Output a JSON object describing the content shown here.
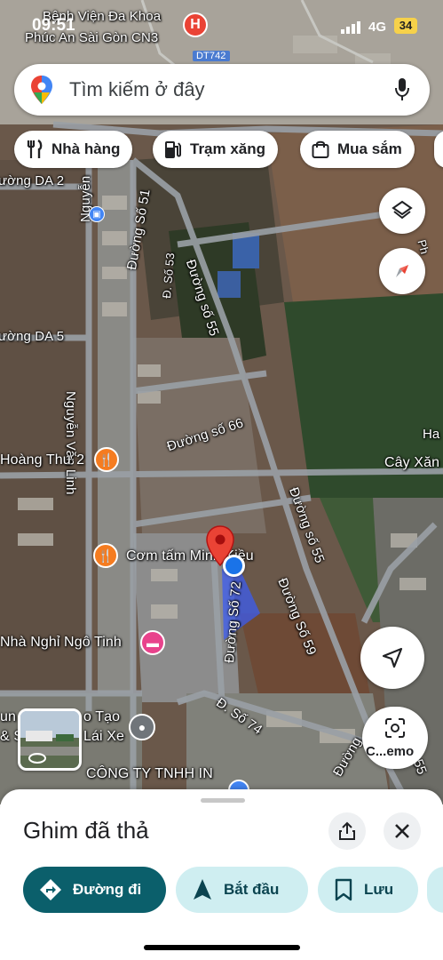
{
  "status_bar": {
    "time": "09:51",
    "network": "4G",
    "battery": "34"
  },
  "search": {
    "placeholder": "Tìm kiếm ở đây",
    "mic_icon": "mic-icon",
    "logo_icon": "maps-pin-logo-icon"
  },
  "chips": [
    {
      "label": "Nhà hàng",
      "icon": "restaurant-icon"
    },
    {
      "label": "Trạm xăng",
      "icon": "gas-station-icon"
    },
    {
      "label": "Mua sắm",
      "icon": "shopping-bag-icon"
    }
  ],
  "map": {
    "labels": {
      "hospital": "Bệnh Viện Đa Khoa",
      "hospital2": "Phúc An Sài Gòn CN3",
      "road_dt742": "DT742",
      "duong_da2": "ường DA 2",
      "duong_da5": "ường DA 5",
      "nguyen_van_linh": "Nguyễn Văn Linh",
      "nguyen_van_linh_top": "Nguyễn",
      "duong_so51": "Đường Số 51",
      "d_so53": "Đ. Số 53",
      "duong_so55": "Đường số 55",
      "duong_so66": "Đường số 66",
      "duong_so55b": "Đường số 55",
      "duong_so59": "Đường Số 59",
      "duong_so72": "Đường Số 72",
      "d_so74": "Đ. Số 74",
      "duong_bottom": "Đường",
      "hoang_thu": "Hoàng Thư 2",
      "com_tam": "Cơm tấm Minh Kiều",
      "nha_nghi": "Nhà Nghỉ Ngô Tinh",
      "dao_tao": "o Tạo",
      "lai_xe": "Lái Xe",
      "trun": "un",
      "s_left": "& S",
      "cong_ty": "CÔNG TY TNHH IN",
      "cay_xang": "Cây Xăn",
      "ha": "Ha",
      "ph": "Ph",
      "num55": "55"
    }
  },
  "buttons": {
    "layers_icon": "layers-icon",
    "compass_icon": "compass-icon",
    "location_icon": "my-location-arrow-icon",
    "lens_label": "C...emo"
  },
  "sheet": {
    "title": "Ghim đã thả",
    "actions": [
      {
        "label": "Đường đi",
        "icon": "directions-icon"
      },
      {
        "label": "Bắt đầu",
        "icon": "navigation-arrow-icon"
      },
      {
        "label": "Lưu",
        "icon": "bookmark-icon"
      }
    ]
  },
  "colors": {
    "accent_teal": "#0b5f6b",
    "chip_teal": "#cfeef1",
    "pin_red": "#ea4335",
    "blue_dot": "#1a73e8",
    "poi_orange": "#f57c20",
    "poi_pink": "#e8438c",
    "poi_blue": "#4285f4"
  }
}
